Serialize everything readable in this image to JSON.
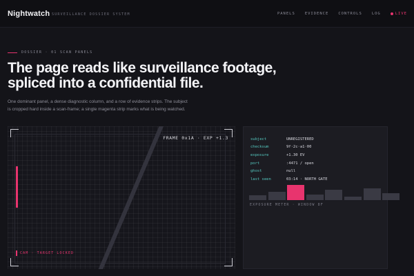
{
  "header": {
    "brand": "Nightwatch",
    "subtitle": "SURVEILLANCE DOSSIER SYSTEM",
    "nav": [
      "PANELS",
      "EVIDENCE",
      "CONTROLS",
      "LOG"
    ],
    "live_label": "LIVE"
  },
  "section": {
    "label": "DOSSIER · 01 SCAN PANELS"
  },
  "hero": {
    "line1": "The page reads like surveillance footage,",
    "line2": "spliced into a confidential file."
  },
  "lead": {
    "line1": "One dominant panel, a dense diagnostic column, and a row of evidence strips. The subject",
    "line2": "is cropped hard inside a scan-frame; a single magenta strip marks what is being watched."
  },
  "scan": {
    "frame_label": "FRAME 0x1A · EXP +1.3",
    "status": "CAM · TARGET LOCKED"
  },
  "diagnostics": {
    "rows": [
      {
        "key": "subject",
        "value": "UNREGISTERED"
      },
      {
        "key": "checksum",
        "value": "9f·2c·a1·00"
      },
      {
        "key": "exposure",
        "value": "+1.30 EV"
      },
      {
        "key": "port",
        "value": ":4471 / open"
      },
      {
        "key": "ghost",
        "value": "null"
      },
      {
        "key": "last seen",
        "value": "03:14 · NORTH GATE"
      }
    ],
    "meter_levels": [
      0.3,
      0.5,
      0.9,
      0.35,
      0.62,
      0.22,
      0.72,
      0.42
    ],
    "meter_active_index": 2,
    "meter_caption": "EXPOSURE METER · WINDOW 8F"
  },
  "colors": {
    "accent": "#e8346e",
    "key": "#55c9c0",
    "background": "#141419"
  }
}
